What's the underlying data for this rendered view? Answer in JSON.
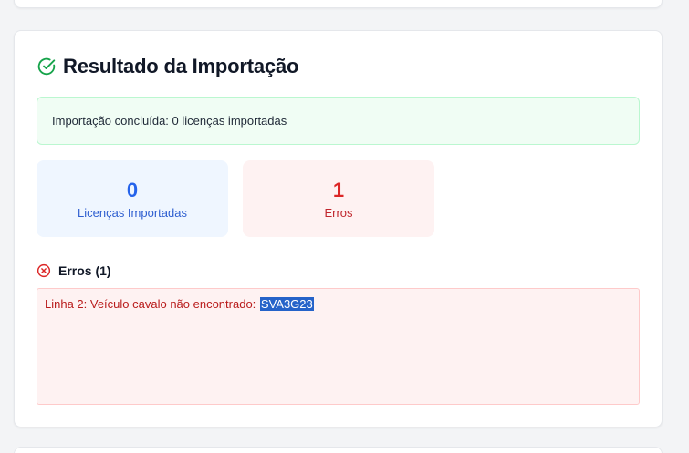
{
  "result": {
    "title": "Resultado da Importação",
    "title_icon": "check-circle-icon",
    "success_message": "Importação concluída: 0 licenças importadas",
    "stats": {
      "imported": {
        "value": "0",
        "label": "Licenças Importadas",
        "color": "#2563eb"
      },
      "errors": {
        "value": "1",
        "label": "Erros",
        "color": "#dc2626"
      }
    },
    "errors_section": {
      "title": "Erros (1)",
      "icon": "x-circle-icon",
      "items": [
        {
          "text": "Linha 2: Veículo cavalo não encontrado:",
          "plate": "SVA3G23"
        }
      ]
    }
  },
  "colors": {
    "success_bg": "#f0fdf4",
    "success_border": "#bbf7d0",
    "accent_green": "#16a34a",
    "error_bg": "#fef2f2",
    "selection": "#2563c9"
  }
}
